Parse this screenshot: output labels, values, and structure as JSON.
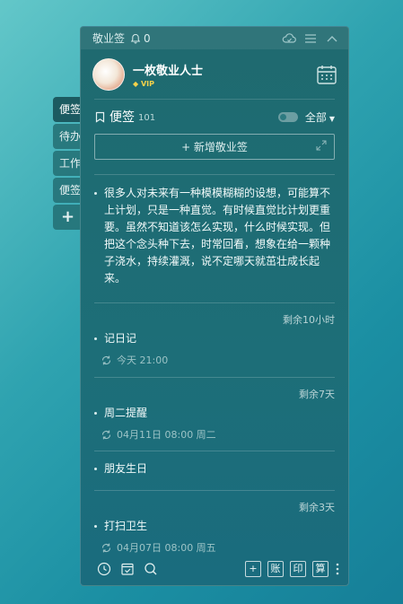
{
  "side_tabs": [
    {
      "label": "便签",
      "active": true
    },
    {
      "label": "待办",
      "active": false
    },
    {
      "label": "工作",
      "active": false
    },
    {
      "label": "便签",
      "active": false
    },
    {
      "label": "+",
      "active": false
    }
  ],
  "topbar": {
    "app_name": "敬业签",
    "notification_count": "0",
    "icons": [
      "bell-icon",
      "cloud-sync-icon",
      "menu-icon",
      "collapse-icon"
    ]
  },
  "profile": {
    "name": "一枚敬业人士",
    "vip_label": "VIP",
    "calendar_icon": "calendar-icon"
  },
  "list": {
    "title": "便签",
    "count": "101",
    "filter": "全部"
  },
  "new_button": {
    "label": "+ 新增敬业签"
  },
  "notes": [
    {
      "remain": "",
      "text": "很多人对未来有一种模模糊糊的设想，可能算不上计划，只是一种直觉。有时候直觉比计划更重要。虽然不知道该怎么实现，什么时候实现。但把这个念头种下去，时常回看，想象在给一颗种子浇水，持续灌溉，说不定哪天就茁壮成长起来。",
      "meta": ""
    },
    {
      "remain": "剩余10小时",
      "text": "记日记",
      "meta": "今天 21:00"
    },
    {
      "remain": "剩余7天",
      "text": "周二提醒",
      "meta": "04月11日 08:00 周二"
    },
    {
      "remain": "",
      "text": "朋友生日",
      "meta": ""
    },
    {
      "remain": "剩余3天",
      "text": "打扫卫生",
      "meta": "04月07日 08:00 周五"
    }
  ],
  "bottombar": {
    "left_icons": [
      "clock-icon",
      "checklist-icon",
      "search-icon"
    ],
    "buttons": [
      "+",
      "账",
      "印",
      "算"
    ]
  },
  "colors": {
    "panel_bg": "#1d6e78",
    "desktop_bg": "#2fa3b0",
    "vip": "#f6d24a"
  }
}
